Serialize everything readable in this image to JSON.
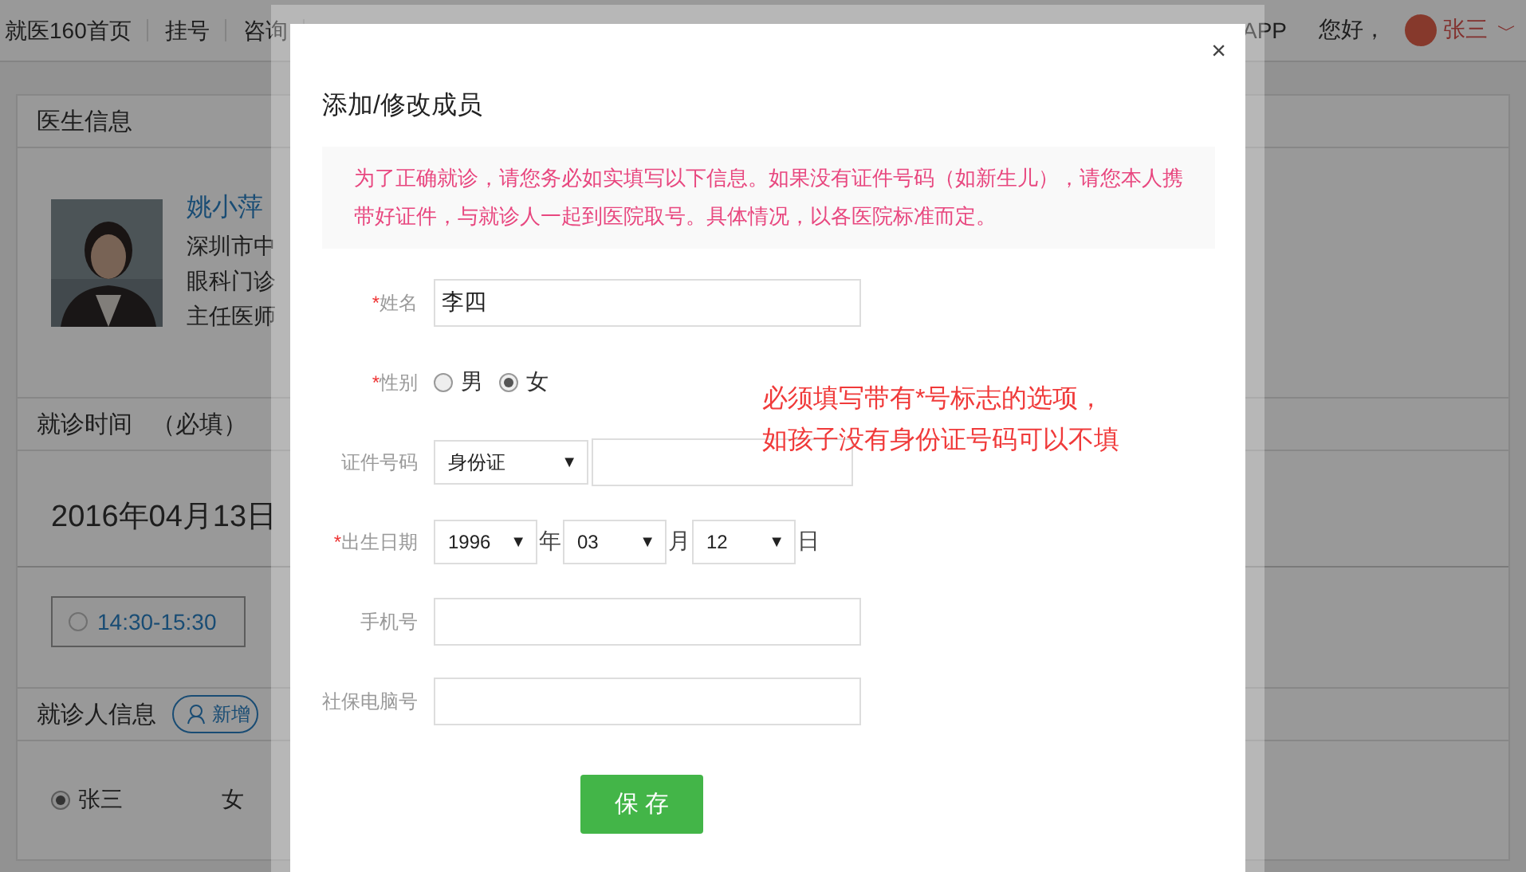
{
  "nav": {
    "links": [
      {
        "label": "就医160首页"
      },
      {
        "label": "挂号"
      },
      {
        "label": "咨询"
      }
    ],
    "right": [
      {
        "label": "APP"
      },
      {
        "label": "您好，"
      }
    ],
    "user": {
      "name": "张三",
      "caret": "﹀"
    }
  },
  "doctor_panel": {
    "title": "医生信息",
    "doctor": {
      "name": "姚小萍",
      "lines": [
        "深圳市中",
        "眼科门诊",
        "主任医师"
      ]
    }
  },
  "visit_time": {
    "title": "就诊时间",
    "note": "（必填）",
    "date": "2016年04月13日",
    "slots": [
      {
        "label": "14:30-15:30",
        "selected": false
      }
    ]
  },
  "patients": {
    "title": "就诊人信息",
    "add_button": "新增",
    "rows": [
      {
        "name": "张三",
        "gender": "女",
        "selected": true
      }
    ]
  },
  "dialog": {
    "title": "添加/修改成员",
    "close": "×",
    "required_mark": "*",
    "caret": "▼",
    "notice": "为了正确就诊，请您务必如实填写以下信息。如果没有证件号码（如新生儿），请您本人携带好证件，与就诊人一起到医院取号。具体情况，以各医院标准而定。",
    "fields": [
      {
        "kind": "text",
        "label": "姓名",
        "required": true,
        "value": "李四"
      },
      {
        "kind": "radio",
        "label": "性别",
        "required": true,
        "options": [
          {
            "label": "男",
            "selected": false
          },
          {
            "label": "女",
            "selected": true
          }
        ]
      },
      {
        "kind": "id",
        "label": "证件号码",
        "required": false,
        "select": "身份证"
      },
      {
        "kind": "date",
        "label": "出生日期",
        "required": true,
        "parts": [
          {
            "value": "1996",
            "unit": "年"
          },
          {
            "value": "03",
            "unit": "月"
          },
          {
            "value": "12",
            "unit": "日"
          }
        ]
      },
      {
        "kind": "text",
        "label": "手机号",
        "required": false
      },
      {
        "kind": "text",
        "label": "社保电脑号",
        "required": false
      }
    ],
    "save_button": "保 存"
  },
  "annotation": [
    "必须填写带有*号标志的选项，",
    "如孩子没有身份证号码可以不填"
  ]
}
